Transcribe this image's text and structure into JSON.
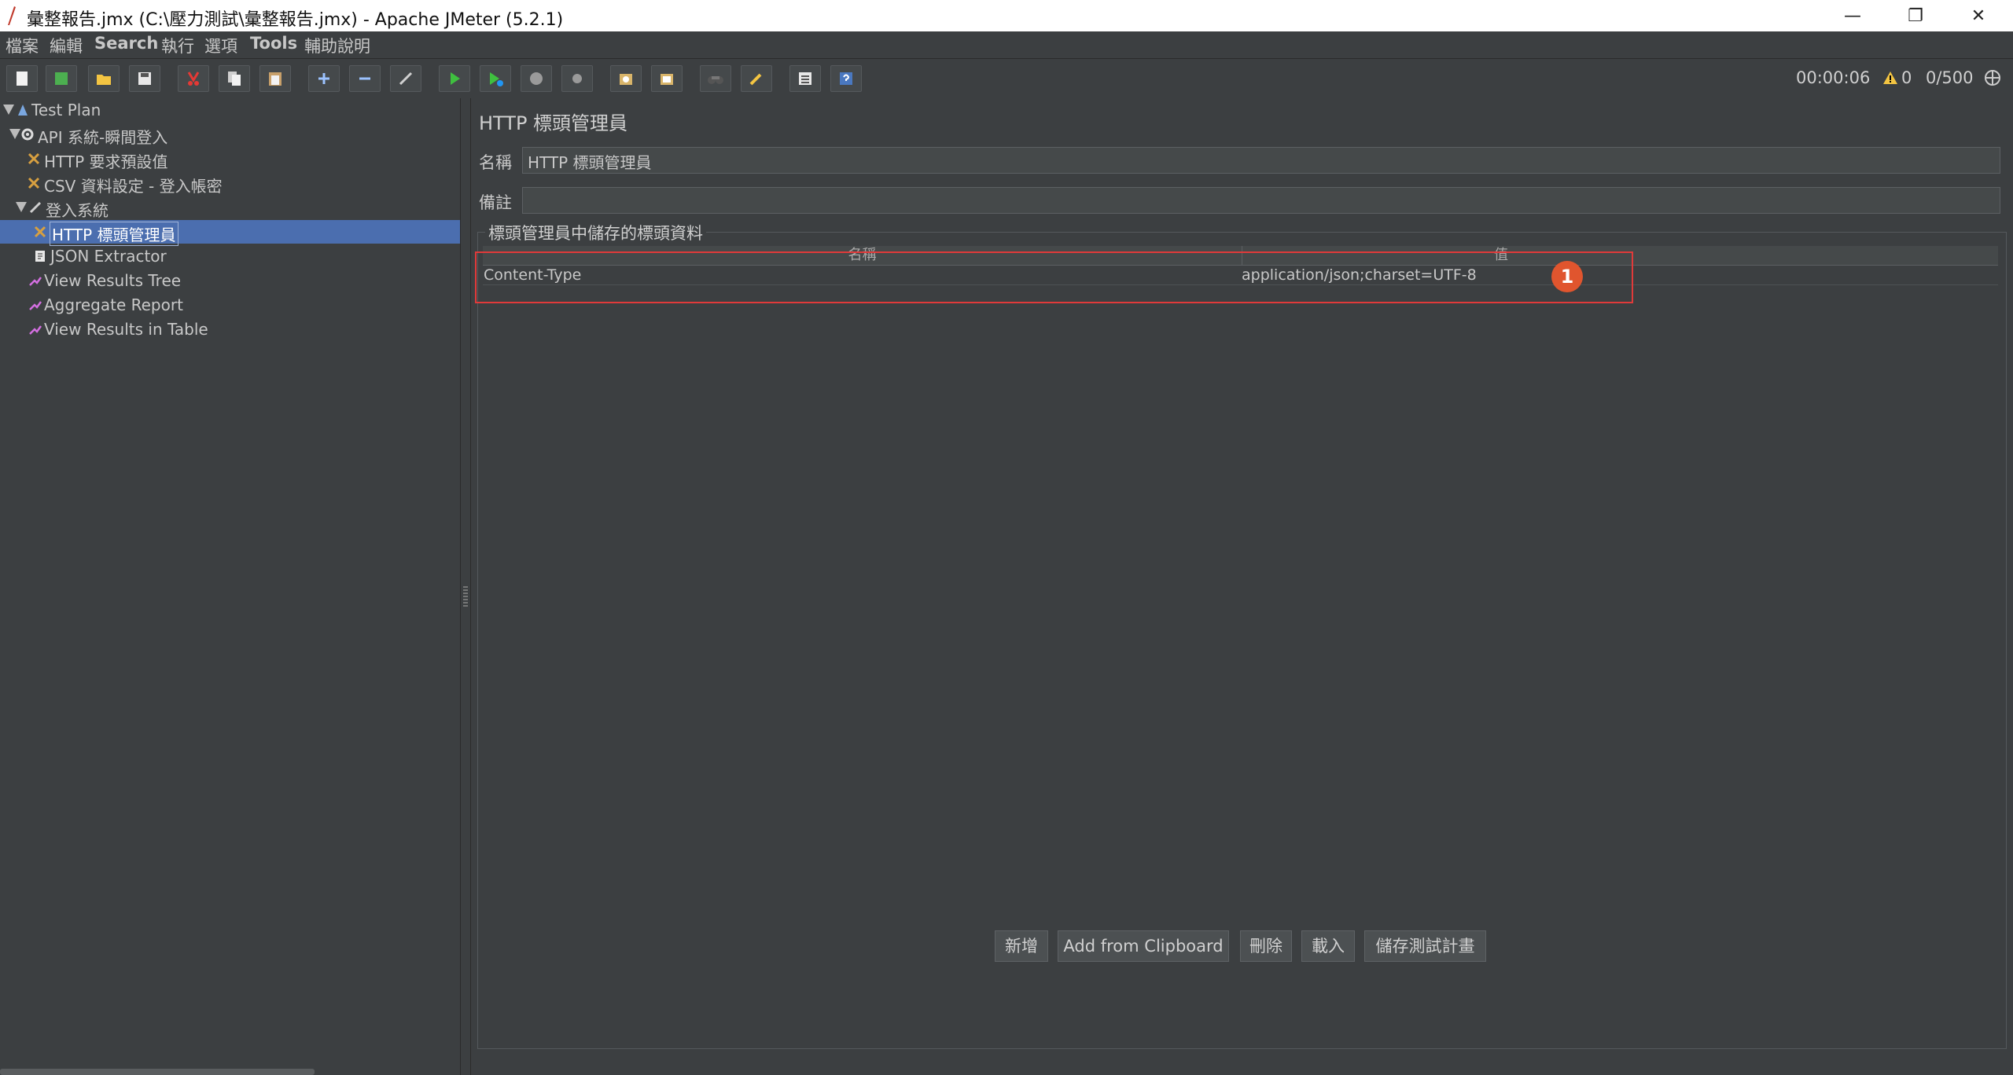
{
  "window": {
    "title": "彙整報告.jmx (C:\\壓力測試\\彙整報告.jmx) - Apache JMeter (5.2.1)",
    "minimize": "—",
    "restore": "❐",
    "close": "✕"
  },
  "menu": [
    "檔案",
    "編輯",
    "Search",
    "執行",
    "選項",
    "Tools",
    "輔助說明"
  ],
  "status": {
    "elapsed": "00:00:06",
    "warnings": "0",
    "threads": "0/500"
  },
  "tree": [
    {
      "label": "Test Plan",
      "icon": "test-plan-icon"
    },
    {
      "label": "API 系統-瞬間登入",
      "icon": "thread-group-icon"
    },
    {
      "label": "HTTP 要求預設值",
      "icon": "config-element-icon"
    },
    {
      "label": "CSV 資料設定 - 登入帳密",
      "icon": "config-element-icon"
    },
    {
      "label": "登入系統",
      "icon": "sampler-icon"
    },
    {
      "label": "HTTP 標頭管理員",
      "icon": "config-element-icon"
    },
    {
      "label": "JSON Extractor",
      "icon": "post-processor-icon"
    },
    {
      "label": "View Results Tree",
      "icon": "listener-icon"
    },
    {
      "label": "Aggregate Report",
      "icon": "listener-icon"
    },
    {
      "label": "View Results in Table",
      "icon": "listener-icon"
    }
  ],
  "panel": {
    "title": "HTTP 標頭管理員",
    "name_label": "名稱",
    "name_value": "HTTP 標頭管理員",
    "comment_label": "備註",
    "comment_value": "",
    "group_title": "標頭管理員中儲存的標頭資料",
    "columns": [
      "名稱",
      "值"
    ],
    "rows": [
      {
        "name": "Content-Type",
        "value": "application/json;charset=UTF-8"
      }
    ],
    "annotation": "1"
  },
  "buttons": {
    "add": "新增",
    "clipboard": "Add from Clipboard",
    "delete": "刪除",
    "load": "載入",
    "save": "儲存測試計畫"
  },
  "colors": {
    "background": "#3c3f41",
    "selection": "#4b6eaf",
    "highlight": "#e03a3a",
    "badge": "#e0552e"
  }
}
